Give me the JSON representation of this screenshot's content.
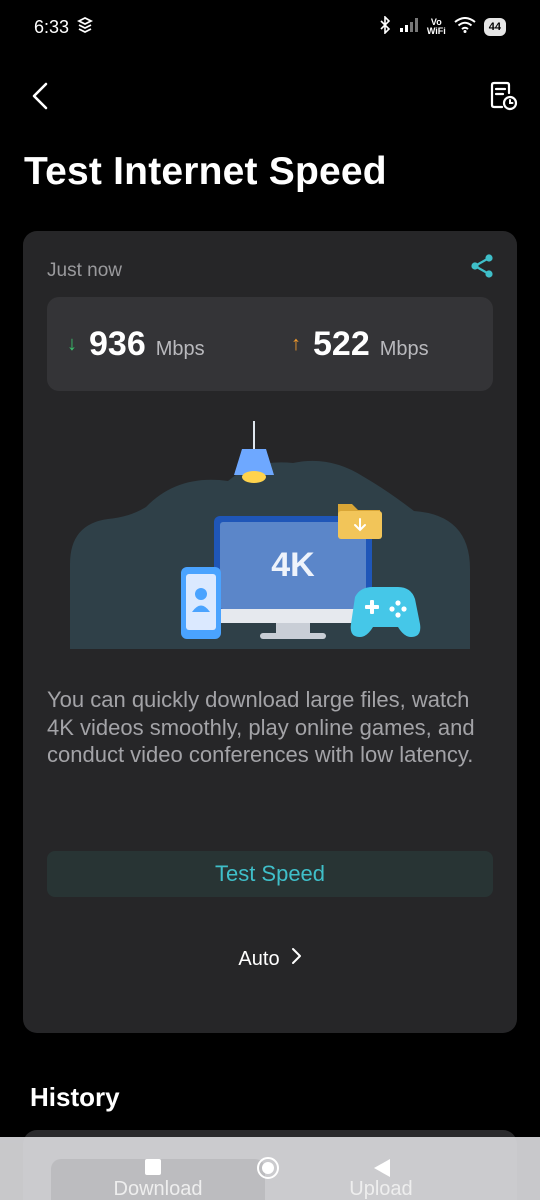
{
  "status_bar": {
    "time": "6:33",
    "vowifi_top": "Vo",
    "vowifi_bottom": "WiFi",
    "battery": "44"
  },
  "header": {
    "title": "Test Internet Speed"
  },
  "result_card": {
    "timestamp": "Just now",
    "download": {
      "value": "936",
      "unit": "Mbps",
      "arrow": "↓"
    },
    "upload": {
      "value": "522",
      "unit": "Mbps",
      "arrow": "↑"
    },
    "illustration_badge": "4K",
    "description": "You can quickly download large files, watch 4K videos smoothly, play online games, and conduct video conferences with low latency.",
    "test_button_label": "Test Speed",
    "mode_label": "Auto"
  },
  "history": {
    "title": "History"
  },
  "tabs": {
    "download_label": "Download",
    "upload_label": "Upload"
  },
  "colors": {
    "accent": "#3fbfc9",
    "download_arrow": "#39c16c",
    "upload_arrow": "#f39a2b",
    "card_bg": "#262628"
  },
  "icons": {
    "back": "chevron-left-icon",
    "history": "document-clock-icon",
    "share": "share-icon",
    "mode_chevron": "chevron-right-icon"
  }
}
